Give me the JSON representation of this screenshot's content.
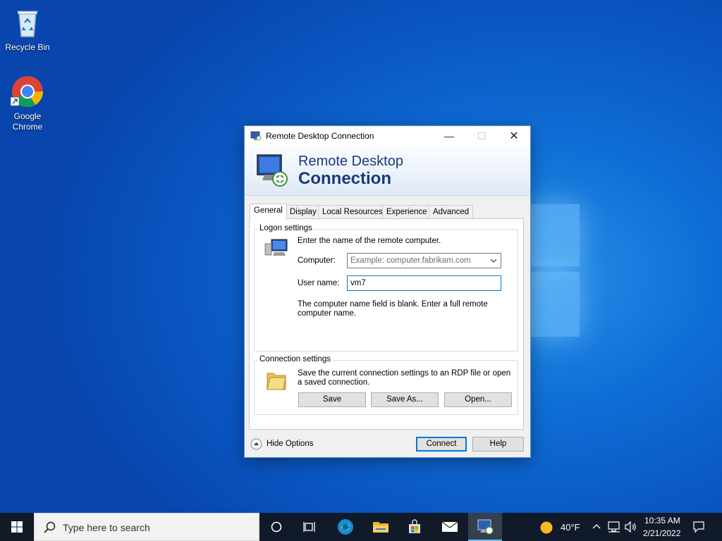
{
  "desktop": {
    "icons": [
      {
        "label": "Recycle Bin"
      },
      {
        "label": "Google\nChrome"
      }
    ]
  },
  "window": {
    "title": "Remote Desktop Connection",
    "banner_line1": "Remote Desktop",
    "banner_line2": "Connection",
    "tabs": [
      {
        "label": "General",
        "active": true
      },
      {
        "label": "Display"
      },
      {
        "label": "Local Resources"
      },
      {
        "label": "Experience"
      },
      {
        "label": "Advanced"
      }
    ],
    "logon": {
      "group_label": "Logon settings",
      "intro": "Enter the name of the remote computer.",
      "computer_label": "Computer:",
      "computer_placeholder": "Example: computer.fabrikam.com",
      "username_label": "User name:",
      "username_value": "vm7",
      "warning": "The computer name field is blank. Enter a full remote computer name."
    },
    "connection": {
      "group_label": "Connection settings",
      "text": "Save the current connection settings to an RDP file or open a saved connection.",
      "save": "Save",
      "save_as": "Save As...",
      "open": "Open..."
    },
    "hide_options": "Hide Options",
    "connect": "Connect",
    "help": "Help"
  },
  "taskbar": {
    "search_placeholder": "Type here to search",
    "weather": "40°F",
    "time": "10:35 AM",
    "date": "2/21/2022"
  },
  "colors": {
    "accent": "#0078d7",
    "banner_text": "#1a3a7a",
    "taskbar": "#101a28"
  }
}
